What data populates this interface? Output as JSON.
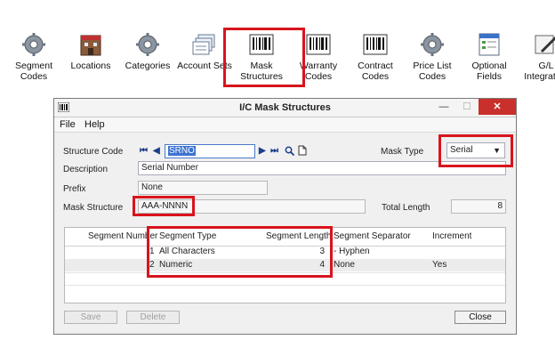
{
  "toolbar": {
    "items": [
      {
        "label": "Segment\nCodes",
        "icon": "gear-icon"
      },
      {
        "label": "Locations",
        "icon": "building-icon"
      },
      {
        "label": "Categories",
        "icon": "gear-icon"
      },
      {
        "label": "Account Sets",
        "icon": "stack-icon"
      },
      {
        "label": "Mask\nStructures",
        "icon": "barcode-icon"
      },
      {
        "label": "Warranty\nCodes",
        "icon": "barcode-icon"
      },
      {
        "label": "Contract\nCodes",
        "icon": "barcode-icon"
      },
      {
        "label": "Price List\nCodes",
        "icon": "gear-icon"
      },
      {
        "label": "Optional\nFields",
        "icon": "form-icon"
      },
      {
        "label": "G/L\nIntegration",
        "icon": "pen-icon"
      }
    ]
  },
  "window": {
    "title": "I/C Mask Structures",
    "min_glyph": "—",
    "max_glyph": "☐",
    "close_glyph": "✕",
    "menu": [
      "File",
      "Help"
    ]
  },
  "form": {
    "structure_code_label": "Structure Code",
    "structure_code": "SRNO",
    "mask_type_label": "Mask Type",
    "mask_type": "Serial",
    "description_label": "Description",
    "description": "Serial Number",
    "prefix_label": "Prefix",
    "prefix": "None",
    "mask_structure_label": "Mask Structure",
    "mask_structure": "AAA-NNNN",
    "total_length_label": "Total Length",
    "total_length": "8"
  },
  "grid": {
    "headers": [
      "Segment Number",
      "Segment Type",
      "Segment Length",
      "Segment Separator",
      "Increment"
    ],
    "rows": [
      {
        "num": "1",
        "type": "All Characters",
        "length": "3",
        "separator": "-  Hyphen",
        "increment": ""
      },
      {
        "num": "2",
        "type": "Numeric",
        "length": "4",
        "separator": "None",
        "increment": "Yes"
      }
    ]
  },
  "buttons": {
    "save": "Save",
    "delete": "Delete",
    "close": "Close"
  },
  "colors": {
    "highlight": "#d8141c",
    "close_button": "#c9302c",
    "selected_text_bg": "#3b74d1"
  }
}
